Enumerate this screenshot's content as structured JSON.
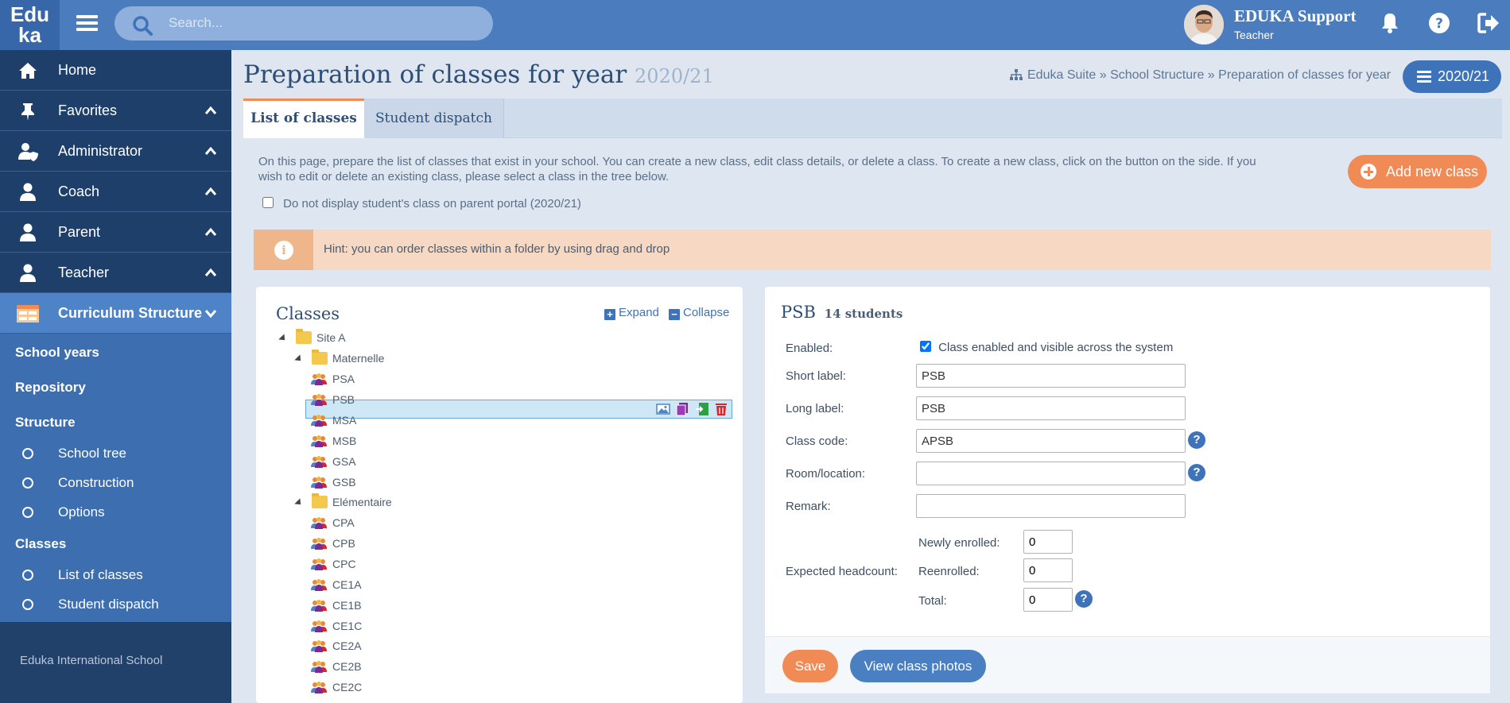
{
  "app": {
    "logo_line1": "Edu",
    "logo_line2": "ka",
    "search_placeholder": "Search..."
  },
  "user": {
    "name": "EDUKA Support",
    "role": "Teacher"
  },
  "sidebar": {
    "items": [
      {
        "label": "Home",
        "icon": "home-icon"
      },
      {
        "label": "Favorites",
        "icon": "pin-icon"
      },
      {
        "label": "Administrator",
        "icon": "user-shield-icon"
      },
      {
        "label": "Coach",
        "icon": "user-icon"
      },
      {
        "label": "Parent",
        "icon": "user-icon"
      },
      {
        "label": "Teacher",
        "icon": "user-icon"
      },
      {
        "label": "Curriculum Structure",
        "icon": "structure-icon"
      }
    ],
    "sub": {
      "school_years": "School years",
      "repository": "Repository",
      "structure": "Structure",
      "school_tree": "School tree",
      "construction": "Construction",
      "options": "Options",
      "classes": "Classes",
      "list_of_classes": "List of classes",
      "student_dispatch": "Student dispatch"
    },
    "footer": "Eduka International School"
  },
  "page": {
    "title": "Preparation of classes for year",
    "title_year": "2020/21",
    "breadcrumb": "Eduka Suite » School Structure » Preparation of classes for year",
    "year_button": "2020/21"
  },
  "tabs": [
    "List of classes",
    "Student dispatch"
  ],
  "intro": {
    "line1": "On this page, prepare the list of classes that exist in your school. You can create a new class, edit class details, or delete a class. To create a new class, click on the button on the side. If you",
    "line2": "wish to edit or delete an existing class, please select a class in the tree below.",
    "checkbox_label": "Do not display student's class on parent portal (2020/21)",
    "checkbox_checked": false,
    "add_button": "Add new class"
  },
  "hint": {
    "text": "Hint: you can order classes within a folder by using drag and drop"
  },
  "tree": {
    "title": "Classes",
    "expand": "Expand",
    "collapse": "Collapse",
    "site": "Site A",
    "folder1": "Maternelle",
    "folder1_items": [
      "PSA",
      "PSB",
      "MSA",
      "MSB",
      "GSA",
      "GSB"
    ],
    "folder2": "Elémentaire",
    "folder2_items": [
      "CPA",
      "CPB",
      "CPC",
      "CE1A",
      "CE1B",
      "CE1C",
      "CE2A",
      "CE2B",
      "CE2C"
    ],
    "selected": "PSB"
  },
  "detail": {
    "title": "PSB",
    "students": "14 students",
    "enabled_label": "Enabled:",
    "enabled_text": "Class enabled and visible across the system",
    "enabled_checked": true,
    "short_label": "Short label:",
    "short_value": "PSB",
    "long_label": "Long label:",
    "long_value": "PSB",
    "code_label": "Class code:",
    "code_value": "APSB",
    "room_label": "Room/location:",
    "room_value": "",
    "remark_label": "Remark:",
    "remark_value": "",
    "headcount_label": "Expected headcount:",
    "newly_label": "Newly enrolled:",
    "newly_value": "0",
    "reenrolled_label": "Reenrolled:",
    "reenrolled_value": "0",
    "total_label": "Total:",
    "total_value": "0",
    "save": "Save",
    "photos": "View class photos"
  },
  "colors": {
    "topbar": "#4b7cbe",
    "sidebar_dark": "#1e3f69",
    "accent_orange": "#f08b56",
    "accent_blue": "#3f73b9"
  }
}
